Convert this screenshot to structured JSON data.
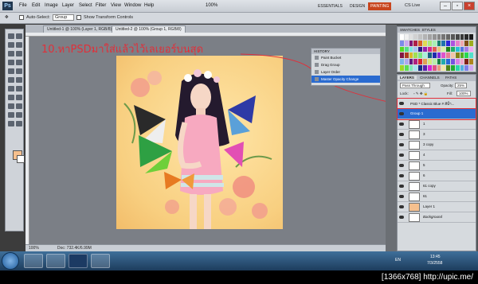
{
  "app": {
    "logo": "Ps",
    "menus": [
      "File",
      "Edit",
      "Image",
      "Layer",
      "Select",
      "Filter",
      "View",
      "Window",
      "Help"
    ],
    "zoom": "100%"
  },
  "workspace": {
    "buttons": [
      "ESSENTIALS",
      "DESIGN",
      "PAINTING"
    ],
    "active": "PAINTING",
    "cs_live": "CS Live"
  },
  "options": {
    "auto_select": "Auto-Select:",
    "auto_select_value": "Group",
    "show_transform": "Show Transform Controls"
  },
  "tabs": [
    "Untitled-1 @ 100% (Layer 1, RGB/8)",
    "Untitled-2 @ 100% (Group 1, RGB/8)"
  ],
  "annotation": "10.หาPSDมาใส่แล้วไว้เลเยอร์บนสุด",
  "history": {
    "title": "HISTORY",
    "items": [
      "Paint Bucket",
      "Drag Group",
      "Layer Order",
      "Master Opacity Change"
    ],
    "selected_index": 3
  },
  "layers_panel": {
    "tabs": [
      "LAYERS",
      "CHANNELS",
      "PATHS"
    ],
    "blend": "Pass Through",
    "opacity_label": "Opacity:",
    "opacity": "25%",
    "lock_label": "Lock:",
    "fill_label": "Fill:",
    "fill": "100%",
    "rows": [
      "PSD * Classic Blue # สีน้ำ...",
      "Group 1",
      "1",
      "3",
      "3 copy",
      "4",
      "5",
      "6",
      "61 copy",
      "61",
      "Layer 1",
      "Background"
    ]
  },
  "swatches_title": "SWATCHES",
  "styles_title": "STYLES",
  "status": {
    "doc": "Doc: 732.4K/6.99M"
  },
  "taskbar": {
    "lang": "EN",
    "time": "13:45",
    "date": "7/3/2558"
  },
  "footer": "[1366x768] http://upic.me/",
  "colors": {
    "accent": "#e0303a",
    "selection": "#2a6bd0",
    "foreground": "#f6c08e"
  }
}
